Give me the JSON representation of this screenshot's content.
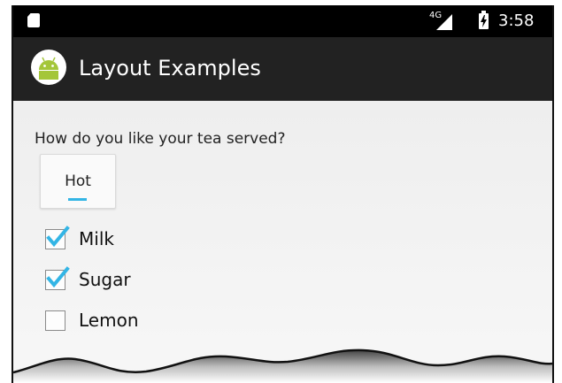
{
  "status_bar": {
    "network": "4G",
    "time": "3:58",
    "icons": [
      "sd-card-icon",
      "signal-icon",
      "battery-charging-icon"
    ]
  },
  "action_bar": {
    "title": "Layout Examples",
    "icon": "android-icon"
  },
  "content": {
    "question": "How do you like your tea served?",
    "spinner": {
      "selected": "Hot"
    },
    "checkboxes": [
      {
        "label": "Milk",
        "checked": true
      },
      {
        "label": "Sugar",
        "checked": true
      },
      {
        "label": "Lemon",
        "checked": false
      }
    ]
  },
  "colors": {
    "action_bar": "#222222",
    "accent": "#33b5e5",
    "android_green": "#a4c639"
  }
}
